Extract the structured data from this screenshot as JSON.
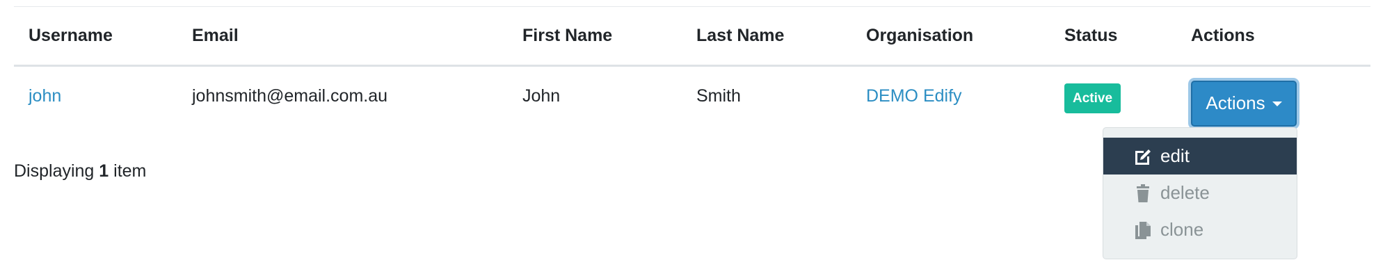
{
  "table": {
    "headers": [
      "Username",
      "Email",
      "First Name",
      "Last Name",
      "Organisation",
      "Status",
      "Actions"
    ],
    "rows": [
      {
        "username": "john",
        "email": "johnsmith@email.com.au",
        "first_name": "John",
        "last_name": "Smith",
        "organisation": "DEMO Edify",
        "status": "Active",
        "actions_label": "Actions"
      }
    ]
  },
  "dropdown": {
    "items": [
      {
        "label": "edit",
        "icon": "edit-icon",
        "active": true
      },
      {
        "label": "delete",
        "icon": "trash-icon",
        "active": false
      },
      {
        "label": "clone",
        "icon": "copy-icon",
        "active": false
      }
    ]
  },
  "footer": {
    "prefix": "Displaying",
    "count": "1",
    "suffix": "item"
  },
  "colors": {
    "link": "#2c8ec3",
    "status_active": "#18bc9c",
    "button_primary": "#2d8ac7",
    "dropdown_active_bg": "#2c3e50",
    "dropdown_bg": "#ecf0f1",
    "muted_text": "#8a9396"
  }
}
